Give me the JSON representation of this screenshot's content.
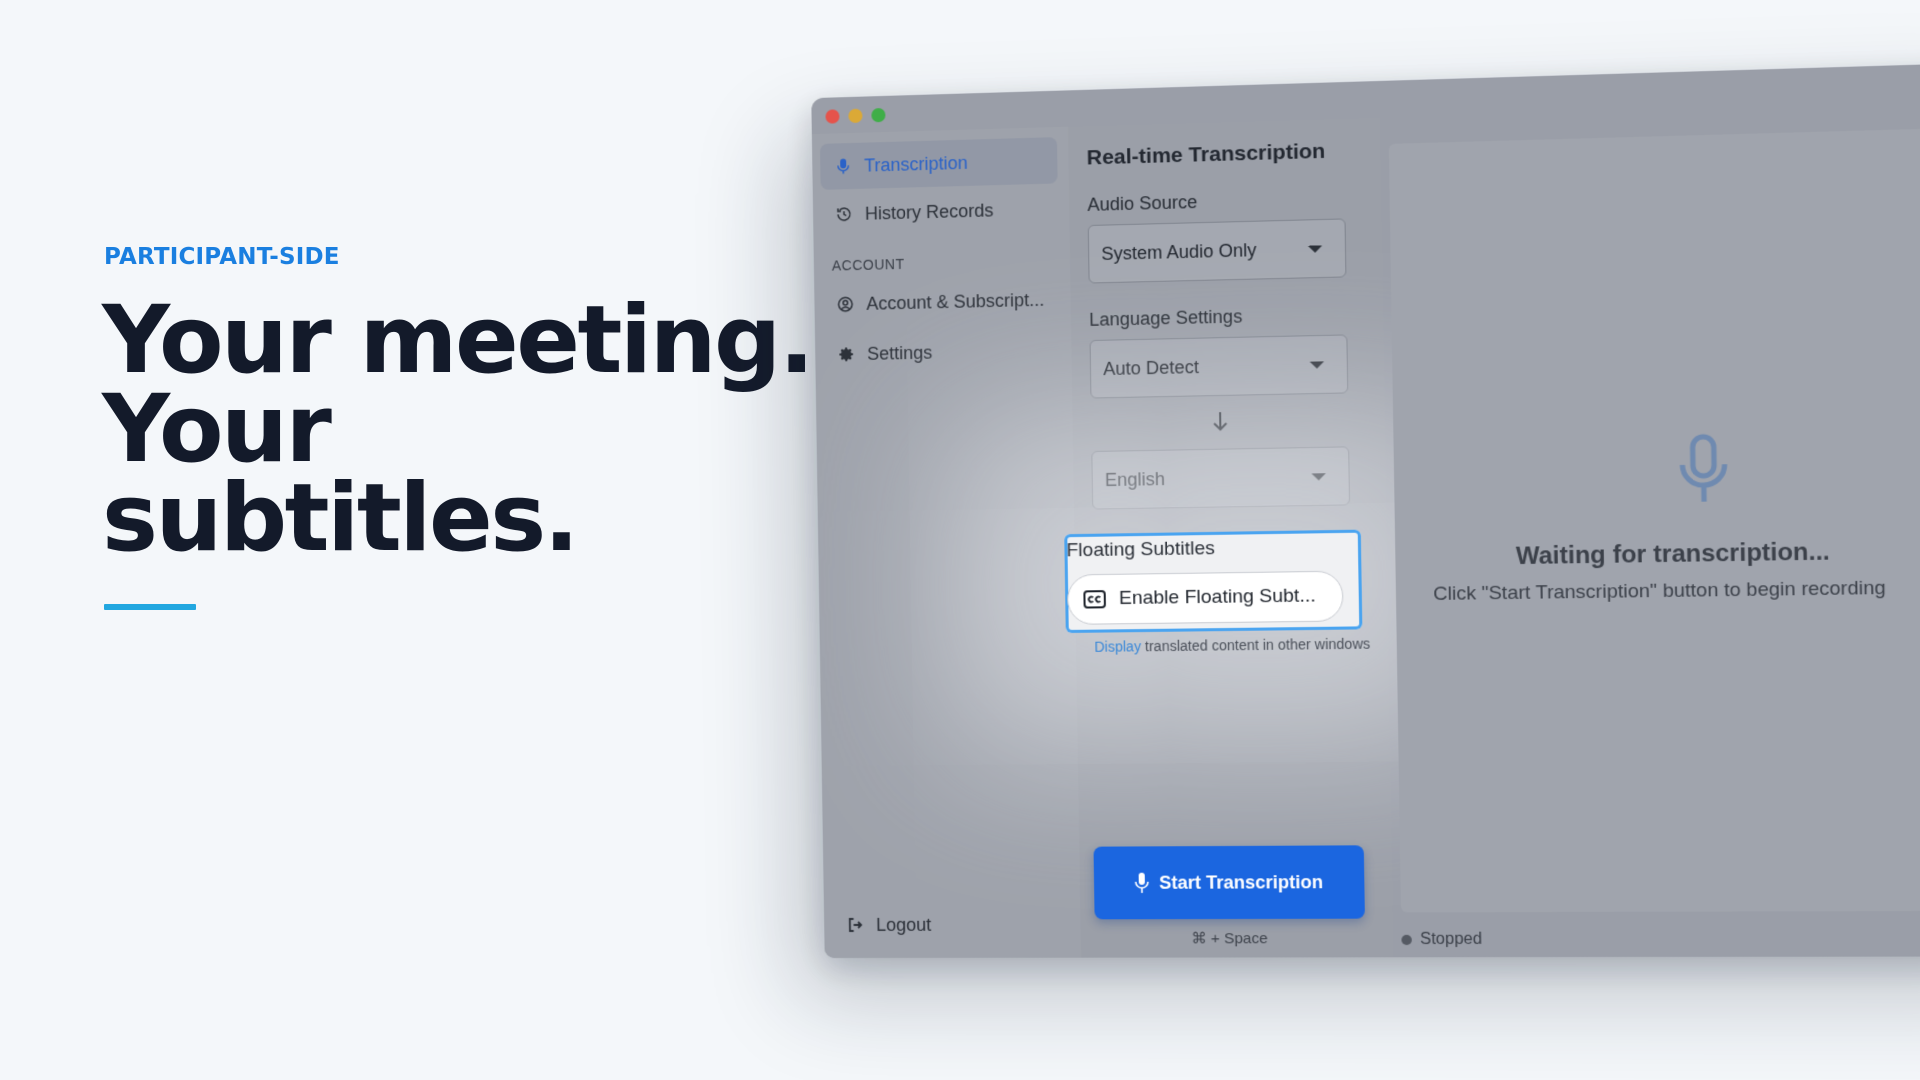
{
  "hero": {
    "eyebrow": "PARTICIPANT-SIDE",
    "headline_line1": "Your meeting.",
    "headline_line2": "Your",
    "headline_line3": "subtitles."
  },
  "colors": {
    "accent_blue": "#1a7fe0",
    "rule_cyan": "#22a7e0",
    "primary_button": "#1b66e0",
    "headline": "#131a2a"
  },
  "sidebar": {
    "items": [
      {
        "label": "Transcription",
        "icon": "microphone-icon",
        "active": true
      },
      {
        "label": "History Records",
        "icon": "history-icon",
        "active": false
      }
    ],
    "section_label": "ACCOUNT",
    "account_items": [
      {
        "label": "Account & Subscript...",
        "icon": "user-circle-icon"
      },
      {
        "label": "Settings",
        "icon": "gear-icon"
      }
    ],
    "logout_label": "Logout"
  },
  "panel": {
    "title": "Real-time Transcription",
    "audio_source_label": "Audio Source",
    "audio_source_value": "System Audio Only",
    "language_label": "Language Settings",
    "source_language_value": "Auto Detect",
    "target_language_value": "English",
    "floating_title": "Floating Subtitles",
    "floating_button_label": "Enable Floating Subt...",
    "floating_help_highlight": "Display",
    "floating_help_rest": " translated content in other windows",
    "start_button_label": "Start Transcription",
    "shortcut": "⌘ + Space"
  },
  "main": {
    "waiting_title": "Waiting for transcription...",
    "waiting_subtitle": "Click \"Start Transcription\" button to begin recording"
  },
  "status": {
    "text": "Stopped"
  }
}
